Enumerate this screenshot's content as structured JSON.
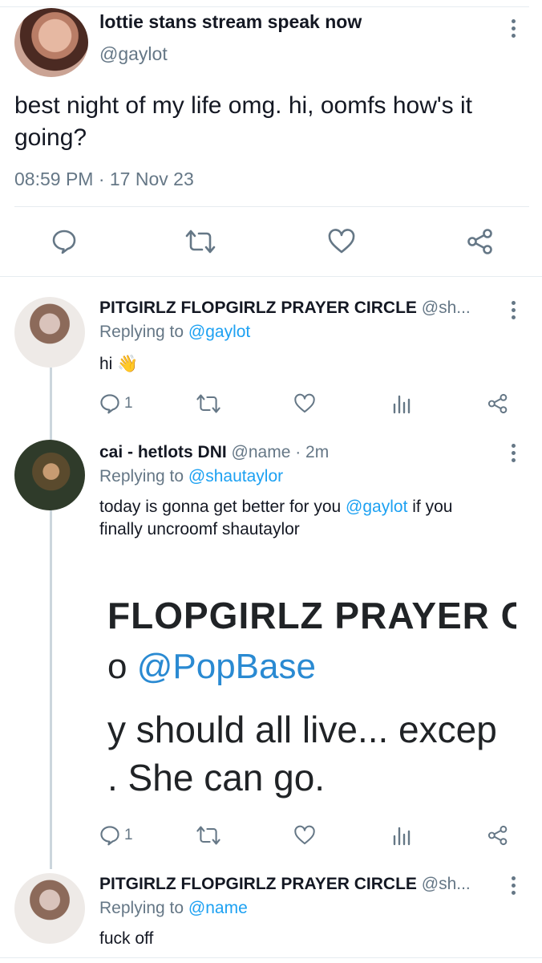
{
  "main_tweet": {
    "display_name": "lottie stans stream speak now",
    "handle": "@gaylot",
    "text": "best night of my life omg. hi, oomfs how's it going?",
    "timestamp": "08:59 PM · 17 Nov 23"
  },
  "replies": [
    {
      "display_name": "PITGIRLZ FLOPGIRLZ PRAYER CIRCLE",
      "handle": "@sh...",
      "replying_prefix": "Replying to",
      "replying_to": "@gaylot",
      "text": "hi 👋",
      "reply_count": "1"
    },
    {
      "display_name": "cai - hetlots DNI",
      "handle": "@name · 2m",
      "replying_prefix": "Replying to",
      "replying_to": "@shautaylor",
      "text_before": "today is gonna get better for you ",
      "text_mention": "@gaylot",
      "text_after": " if you",
      "text_line2": "finally uncroomf shautaylor",
      "embed": {
        "line1": "FLOPGIRLZ PRAYER C",
        "line2_prefix": "o ",
        "line2_mention": "@PopBase",
        "line3": "y should all live... excep",
        "line4": ". She can go."
      },
      "reply_count": "1"
    },
    {
      "display_name": "PITGIRLZ FLOPGIRLZ PRAYER CIRCLE",
      "handle": "@sh...",
      "replying_prefix": "Replying to",
      "replying_to": "@name",
      "text": "fuck off"
    }
  ],
  "icons": {
    "reply": "reply-icon",
    "retweet": "retweet-icon",
    "like": "heart-icon",
    "share": "share-icon",
    "analytics": "analytics-icon",
    "more": "more-icon"
  },
  "colors": {
    "link": "#1da1f2",
    "secondary_text": "#657786",
    "divider": "#e6ecf0",
    "thread_line": "#ccd6dd"
  }
}
